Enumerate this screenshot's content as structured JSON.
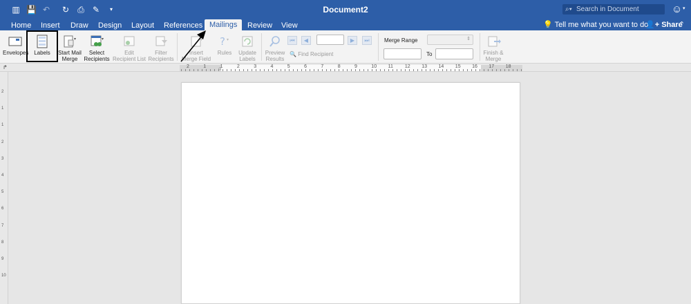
{
  "window": {
    "title": "Document2"
  },
  "search": {
    "placeholder": "Search in Document"
  },
  "tabs": [
    {
      "label": "Home"
    },
    {
      "label": "Insert"
    },
    {
      "label": "Draw"
    },
    {
      "label": "Design"
    },
    {
      "label": "Layout"
    },
    {
      "label": "References"
    },
    {
      "label": "Mailings"
    },
    {
      "label": "Review"
    },
    {
      "label": "View"
    }
  ],
  "header_right": {
    "tell_me": "Tell me what you want to do",
    "share": "Share"
  },
  "ribbon": {
    "envelopes": "Envelopes",
    "labels": "Labels",
    "start_mail_merge_1": "Start Mail",
    "start_mail_merge_2": "Merge",
    "select_recipients_1": "Select",
    "select_recipients_2": "Recipients",
    "edit_recipient_list_1": "Edit",
    "edit_recipient_list_2": "Recipient List",
    "filter_recipients_1": "Filter",
    "filter_recipients_2": "Recipients",
    "insert_merge_field_1": "Insert",
    "insert_merge_field_2": "Merge Field",
    "rules": "Rules",
    "update_labels_1": "Update",
    "update_labels_2": "Labels",
    "preview_results_1": "Preview",
    "preview_results_2": "Results",
    "find_recipient": "Find Recipient",
    "merge_range": "Merge Range",
    "to": "To",
    "finish_merge_1": "Finish &",
    "finish_merge_2": "Merge"
  },
  "ruler": {
    "h_numbers": [
      "2",
      "1",
      "1",
      "2",
      "3",
      "4",
      "5",
      "6",
      "7",
      "8",
      "9",
      "10",
      "11",
      "12",
      "13",
      "14",
      "15",
      "16",
      "17",
      "18"
    ],
    "v_numbers": [
      "2",
      "1",
      "1",
      "2",
      "3",
      "4",
      "5",
      "6",
      "7",
      "8",
      "9",
      "10"
    ]
  },
  "colors": {
    "accent": "#2d5ea8",
    "ribbon_bg": "#f3f3f3",
    "canvas_bg": "#e6e6e6"
  }
}
